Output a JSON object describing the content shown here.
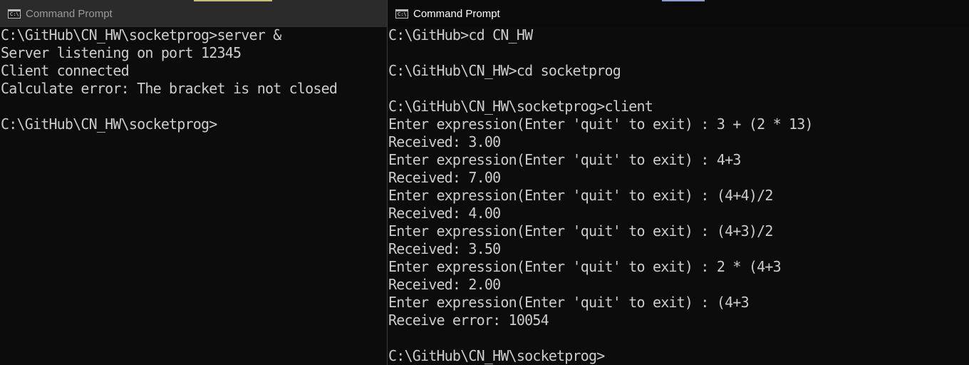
{
  "left_window": {
    "title": "Command Prompt",
    "lines": [
      "C:\\GitHub\\CN_HW\\socketprog>server &",
      "Server listening on port 12345",
      "Client connected",
      "Calculate error: The bracket is not closed",
      "",
      "C:\\GitHub\\CN_HW\\socketprog>"
    ]
  },
  "right_window": {
    "title": "Command Prompt",
    "lines": [
      "C:\\GitHub>cd CN_HW",
      "",
      "C:\\GitHub\\CN_HW>cd socketprog",
      "",
      "C:\\GitHub\\CN_HW\\socketprog>client",
      "Enter expression(Enter 'quit' to exit) : 3 + (2 * 13)",
      "Received: 3.00",
      "Enter expression(Enter 'quit' to exit) : 4+3",
      "Received: 7.00",
      "Enter expression(Enter 'quit' to exit) : (4+4)/2",
      "Received: 4.00",
      "Enter expression(Enter 'quit' to exit) : (4+3)/2",
      "Received: 3.50",
      "Enter expression(Enter 'quit' to exit) : 2 * (4+3",
      "Received: 2.00",
      "Enter expression(Enter 'quit' to exit) : (4+3",
      "Receive error: 10054",
      "",
      "C:\\GitHub\\CN_HW\\socketprog>"
    ]
  },
  "icons": {
    "window_icon": "cmd-icon",
    "icon_text": "C:\\."
  },
  "colors": {
    "terminal_bg": "#0c0c0c",
    "terminal_text": "#cccccc",
    "inactive_titlebar": "#2b2b2b",
    "active_titlebar": "#0a0a0a"
  }
}
